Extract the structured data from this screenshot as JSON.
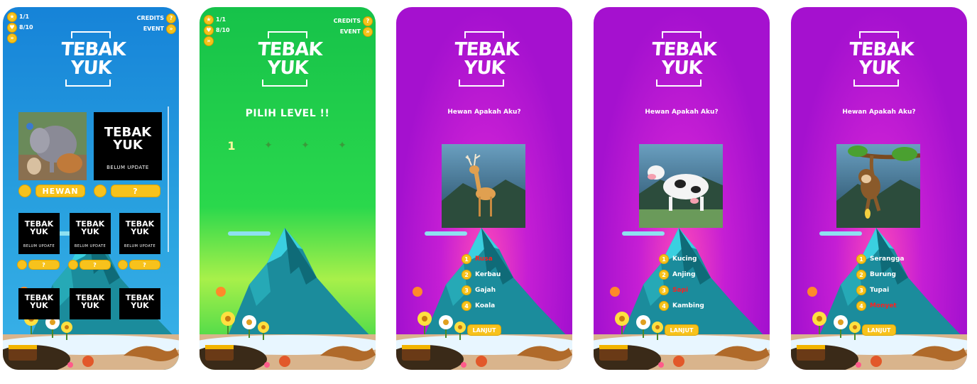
{
  "hud": {
    "stars": "1/1",
    "gems": "8/10",
    "credits": "CREDITS",
    "event": "EVENT"
  },
  "logo": {
    "line1": "TEBAK",
    "line2": "YUK"
  },
  "screen1": {
    "category_button": "HEWAN",
    "locked_button": "?",
    "coming_soon": "BELUM UPDATE",
    "small_coming_soon": "BELUM UPDATE"
  },
  "screen2": {
    "title": "PILIH LEVEL !!",
    "level1": "1"
  },
  "quiz": {
    "question": "Hewan Apakah Aku?",
    "next_button": "LANJUT",
    "q3": {
      "options": [
        "Rusa",
        "Kerbau",
        "Gajah",
        "Koala"
      ],
      "highlight": 0
    },
    "q4": {
      "options": [
        "Kucing",
        "Anjing",
        "Sapi",
        "Kambing"
      ],
      "highlight": 2
    },
    "q5": {
      "options": [
        "Serangga",
        "Burung",
        "Tupai",
        "Monyet"
      ],
      "highlight": 3
    }
  },
  "colors": {
    "blue_bg": "#1683d8",
    "green_bg": "#16c24a",
    "purple_bg": "#a511cf",
    "gold": "#f7c21c",
    "wrong_red": "#ff2020"
  }
}
